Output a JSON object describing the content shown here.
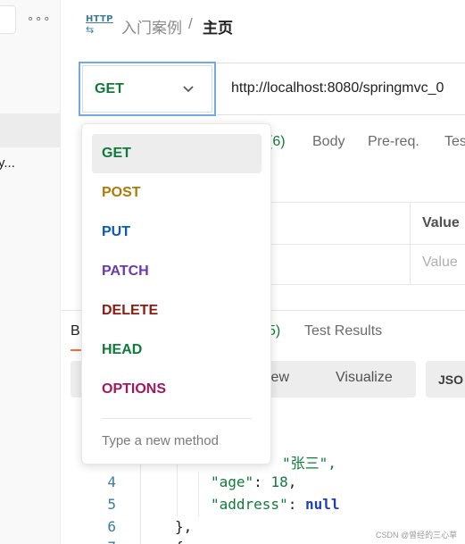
{
  "sidebar": {
    "more_label": "∘∘∘",
    "partial_item_text": "y..."
  },
  "header": {
    "icon_text": "HTTP",
    "icon_arrows": "⇆",
    "breadcrumb_parent": "入门案例",
    "breadcrumb_separator": "/",
    "breadcrumb_current": "主页"
  },
  "request": {
    "method": "GET",
    "method_color": "#0f7b3b",
    "url": "http://localhost:8080/springmvc_0"
  },
  "request_tabs": [
    {
      "label": "(6)"
    },
    {
      "label": "Body"
    },
    {
      "label": "Pre-req."
    },
    {
      "label": "Tes"
    }
  ],
  "params": {
    "value_header": "Value",
    "value_placeholder": "Value"
  },
  "response": {
    "tab_body_partial": "B",
    "tab_headers_count": "5)",
    "tab_test_results": "Test Results",
    "view_preview_partial": "iew",
    "view_visualize": "Visualize",
    "format_label": "JSO"
  },
  "code": {
    "line_numbers": [
      "4",
      "5",
      "6",
      "7"
    ],
    "line3_value": "\"张三\",",
    "line4_key": "\"age\"",
    "line4_sep": ": ",
    "line4_value": "18",
    "line4_end": ",",
    "line5_key": "\"address\"",
    "line5_sep": ": ",
    "line5_value": "null",
    "line6_text": "},",
    "line7_text": "{"
  },
  "method_dropdown": {
    "options": [
      {
        "label": "GET",
        "color": "#0f7b3b"
      },
      {
        "label": "POST",
        "color": "#ad7a03"
      },
      {
        "label": "PUT",
        "color": "#0b5bb5"
      },
      {
        "label": "PATCH",
        "color": "#6b3aa8"
      },
      {
        "label": "DELETE",
        "color": "#8e1a10"
      },
      {
        "label": "HEAD",
        "color": "#0f7b3b"
      },
      {
        "label": "OPTIONS",
        "color": "#a3175e"
      }
    ],
    "selected": "GET",
    "custom_placeholder": "Type a new method"
  },
  "watermark": "CSDN @曾经的三心草"
}
